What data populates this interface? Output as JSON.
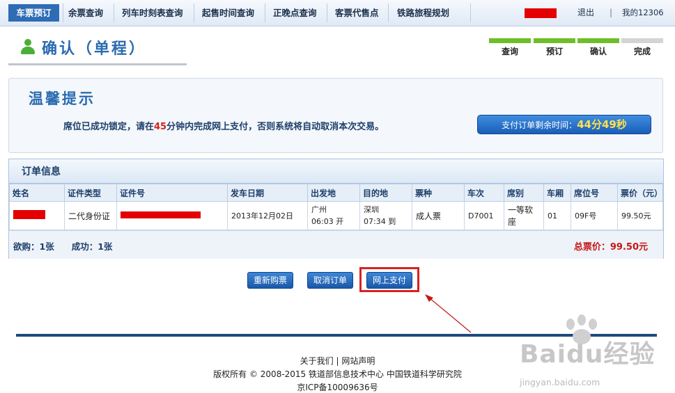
{
  "nav": {
    "items": [
      "车票预订",
      "余票查询",
      "列车时刻表查询",
      "起售时间查询",
      "正晚点查询",
      "客票代售点",
      "铁路旅程规划"
    ],
    "logout": "退出",
    "separator": "|",
    "my12306": "我的12306"
  },
  "page": {
    "title": "确认（单程）"
  },
  "steps": [
    {
      "label": "查询",
      "done": true
    },
    {
      "label": "预订",
      "done": true
    },
    {
      "label": "确认",
      "done": true
    },
    {
      "label": "完成",
      "done": false
    }
  ],
  "tip": {
    "title": "温馨提示",
    "message_prefix": "席位已成功锁定，请在",
    "minutes": "45",
    "message_suffix": "分钟内完成网上支付，否则系统将自动取消本次交易。",
    "timer_label": "支付订单剩余时间：",
    "timer_value": "44分49秒"
  },
  "order": {
    "title": "订单信息",
    "columns": [
      "姓名",
      "证件类型",
      "证件号",
      "发车日期",
      "出发地",
      "目的地",
      "票种",
      "车次",
      "席别",
      "车厢",
      "席位号",
      "票价（元）"
    ],
    "row": {
      "id_type": "二代身份证",
      "date": "2013年12月02日",
      "from": "广州",
      "depart_time": "06:03 开",
      "to": "深圳",
      "arrive_time": "07:34 到",
      "ticket_type": "成人票",
      "train": "D7001",
      "seat_class": "一等软座",
      "car": "01",
      "seat": "09F号",
      "price": "99.50元"
    },
    "summary_left": "欲购：1张　　成功：1张",
    "total": "总票价：99.50元"
  },
  "buttons": {
    "rebook": "重新购票",
    "cancel": "取消订单",
    "pay": "网上支付"
  },
  "footer": {
    "about": "关于我们",
    "statement": "网站声明",
    "copyright": "版权所有 © 2008-2015 铁道部信息技术中心 中国铁道科学研究院",
    "icp": "京ICP备10009636号"
  },
  "watermark": {
    "text": "Baidu经验",
    "url": "jingyan.baidu.com"
  },
  "colors": {
    "accent": "#2a6bb0",
    "step_done": "#6fbe29",
    "warning": "#d9201b"
  }
}
